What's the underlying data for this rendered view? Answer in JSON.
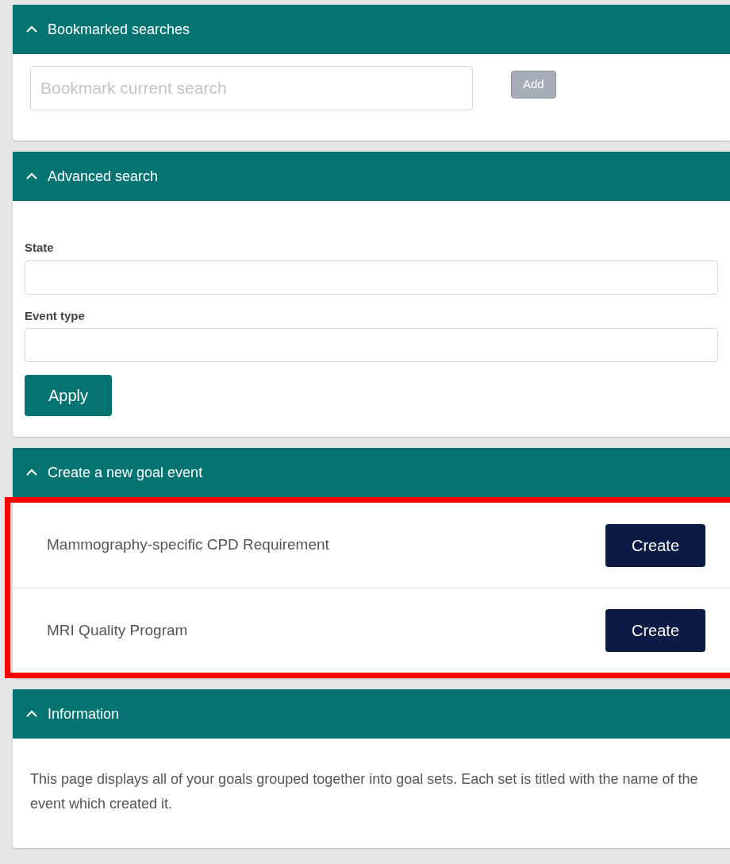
{
  "sections": [
    {
      "kind": "bookmark",
      "title": "Bookmarked searches",
      "expanded": true,
      "field": {
        "placeholder": "Bookmark current search"
      },
      "button": {
        "label": "Add",
        "disabled": true
      }
    },
    {
      "kind": "filters",
      "title": "Advanced search",
      "expanded": true,
      "fields": [
        {
          "label": "State"
        },
        {
          "label": "Event type"
        }
      ],
      "button": {
        "label": "Apply"
      }
    },
    {
      "kind": "events",
      "title": "Create a new goal event",
      "expanded": true,
      "highlighted": true,
      "rows": [
        {
          "name": "Mammography-specific CPD Requirement",
          "button": "Create"
        },
        {
          "name": "MRI Quality Program",
          "button": "Create"
        }
      ]
    },
    {
      "kind": "info",
      "title": "Information",
      "expanded": true,
      "text": "This page displays all of your goals grouped together into goal sets. Each set is titled with the name of the event which created it."
    }
  ]
}
